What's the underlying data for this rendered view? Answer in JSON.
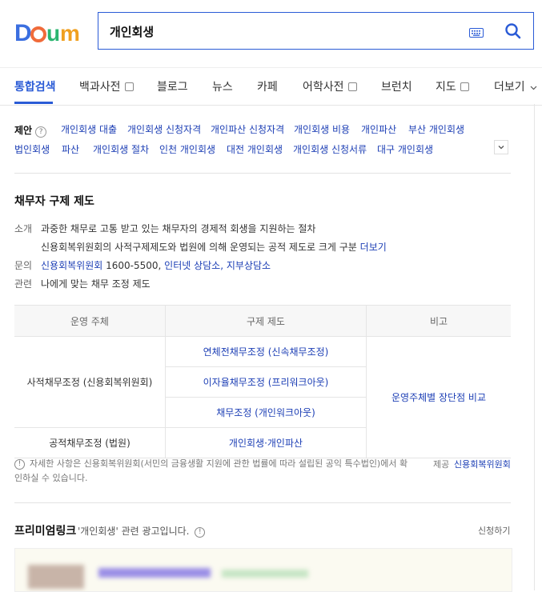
{
  "header": {
    "logo_text": "Daum",
    "search_value": "개인회생",
    "keyboard_icon": "keyboard-icon",
    "search_icon": "search-icon"
  },
  "nav": {
    "tabs": [
      {
        "label": "통합검색"
      },
      {
        "label": "백과사전"
      },
      {
        "label": "블로그"
      },
      {
        "label": "뉴스"
      },
      {
        "label": "카페"
      },
      {
        "label": "어학사전"
      },
      {
        "label": "브런치"
      },
      {
        "label": "지도"
      },
      {
        "label": "더보기"
      }
    ]
  },
  "suggest": {
    "title": "제안",
    "help": "?",
    "row1": [
      "개인회생 대출",
      "개인회생 신청자격",
      "개인파산 신청자격",
      "개인회생 비용",
      "개인파산",
      "부산 개인회생"
    ],
    "row2": [
      "법인회생",
      "파산",
      "개인회생 절차",
      "인천 개인회생",
      "대전 개인회생",
      "개인회생 신청서류",
      "대구 개인회생"
    ]
  },
  "info": {
    "title": "채무자 구제 제도",
    "intro_label": "소개",
    "intro_line1": "과중한 채무로 고통 받고 있는 채무자의 경제적 회생을 지원하는 절차",
    "intro_line2": "신용회복위원회의 사적구제제도와 법원에 의해 운영되는 공적 제도로 크게 구분",
    "more": "더보기",
    "contact_label": "문의",
    "contact_org": "신용회복위원회",
    "contact_phone": "1600-5500,",
    "contact_link1": "인터넷 상담소,",
    "contact_link2": "지부상담소",
    "related_label": "관련",
    "related_link": "나에게 맞는 채무 조정 제도"
  },
  "table": {
    "headers": [
      "운영 주체",
      "구제 제도",
      "비고"
    ],
    "private_org": "사적채무조정 (신용회복위원회)",
    "public_org": "공적채무조정 (법원)",
    "private_items": [
      "연체전채무조정 (신속채무조정)",
      "이자율채무조정 (프리워크아웃)",
      "채무조정 (개인워크아웃)"
    ],
    "public_item": "개인회생·개인파산",
    "note_link": "운영주체별 장단점 비교"
  },
  "note": {
    "text": "자세한 사항은 신용회복위원회(서민의 금융생활 지원에 관한 법률에 따라 설립된 공익 특수법인)에서 확인하실 수 있습니다.",
    "source_label": "제공",
    "source_link": "신용회복위원회"
  },
  "premium": {
    "title": "프리미엄링크",
    "subtitle": "'개인회생' 관련 광고입니다.",
    "apply": "신청하기"
  },
  "colors": {
    "accent": "#2a5bd6",
    "link": "#1d3fb5"
  }
}
